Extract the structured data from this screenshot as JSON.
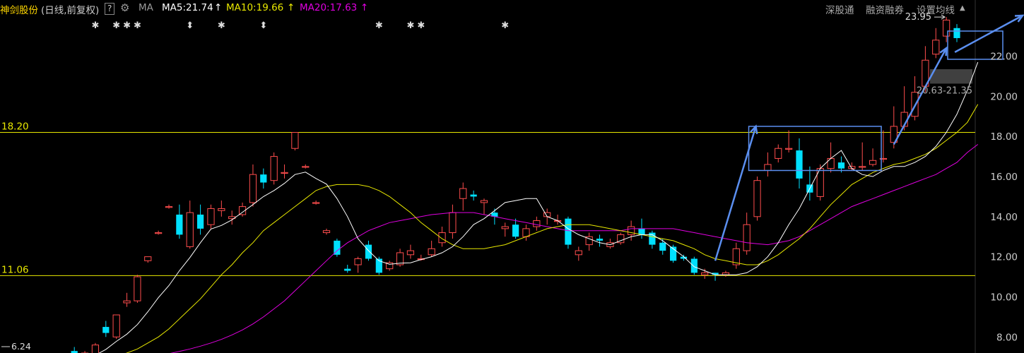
{
  "header": {
    "stock_name": "神剑股份",
    "period_info": "(日线,前复权)",
    "help": "?",
    "ma_label": "MA",
    "ma5": "MA5:21.74",
    "ma10": "MA10:19.66",
    "ma20": "MA20:17.63",
    "arrow": "↑",
    "btn_shenguotong": "深股通",
    "btn_margin": "融资融券",
    "btn_ma_settings": "设置均线"
  },
  "colors": {
    "up": "#ff4d4d",
    "down": "#00e0ff",
    "ma5": "#ffffff",
    "ma10": "#e8e800",
    "ma20": "#e000e0",
    "hline": "#e8e800",
    "annotation": "#5b8ff0",
    "axis_text": "#cccccc"
  },
  "chart_data": {
    "type": "candlestick",
    "y_range": [
      7.2,
      24.8
    ],
    "y_ticks": [
      "8.00",
      "10.00",
      "12.00",
      "14.00",
      "16.00",
      "18.00",
      "20.00",
      "22.00"
    ],
    "y_tick_values": [
      8,
      10,
      12,
      14,
      16,
      18,
      20,
      22
    ],
    "support_line": {
      "value": 11.06,
      "label": "11.06"
    },
    "resistance_line": {
      "value": 18.2,
      "label": "18.20"
    },
    "low_label": "6.24",
    "high_label": "23.95",
    "range_label": "20.63-21.35",
    "range_band": [
      20.63,
      21.35
    ],
    "events_star": [
      8,
      10,
      11,
      12,
      20,
      35,
      38,
      39,
      47
    ],
    "events_diamond": [
      17,
      24
    ],
    "candles": [
      [
        6.6,
        6.65,
        6.5,
        6.7
      ],
      [
        6.65,
        6.7,
        6.6,
        6.75
      ],
      [
        6.7,
        6.65,
        6.55,
        6.8
      ],
      [
        6.65,
        6.75,
        6.6,
        6.8
      ],
      [
        6.75,
        6.7,
        6.6,
        6.8
      ],
      [
        6.7,
        6.8,
        6.6,
        6.85
      ],
      [
        7.3,
        7.1,
        6.9,
        7.5
      ],
      [
        7.0,
        7.2,
        6.9,
        7.3
      ],
      [
        7.1,
        7.6,
        6.9,
        7.7
      ],
      [
        8.5,
        8.2,
        8.0,
        8.8
      ],
      [
        8.0,
        9.1,
        7.9,
        9.1
      ],
      [
        9.7,
        9.8,
        9.5,
        10.2
      ],
      [
        9.8,
        11.0,
        9.7,
        11.1
      ],
      [
        11.8,
        12.0,
        11.7,
        12.0
      ],
      [
        13.2,
        13.2,
        13.1,
        13.3
      ],
      [
        14.5,
        14.5,
        14.4,
        14.6
      ],
      [
        14.1,
        13.1,
        12.9,
        14.6
      ],
      [
        12.5,
        14.2,
        12.4,
        14.8
      ],
      [
        14.1,
        13.4,
        13.1,
        14.6
      ],
      [
        13.6,
        14.4,
        13.4,
        14.6
      ],
      [
        14.3,
        14.4,
        14.0,
        14.8
      ],
      [
        13.9,
        14.0,
        13.6,
        14.3
      ],
      [
        14.1,
        14.5,
        14.0,
        14.7
      ],
      [
        14.7,
        16.1,
        14.5,
        16.6
      ],
      [
        16.1,
        15.7,
        15.4,
        16.4
      ],
      [
        15.8,
        17.0,
        15.6,
        17.2
      ],
      [
        16.2,
        16.2,
        15.9,
        16.6
      ],
      [
        17.4,
        18.2,
        17.3,
        18.2
      ],
      [
        16.5,
        16.5,
        16.4,
        16.6
      ],
      [
        14.7,
        14.7,
        14.6,
        14.8
      ],
      [
        13.2,
        13.3,
        13.1,
        13.4
      ],
      [
        12.8,
        12.1,
        12.0,
        12.9
      ],
      [
        11.4,
        11.3,
        11.2,
        11.6
      ],
      [
        11.6,
        11.9,
        11.2,
        12.0
      ],
      [
        12.6,
        11.9,
        11.8,
        12.8
      ],
      [
        11.9,
        11.2,
        11.1,
        12.0
      ],
      [
        11.4,
        11.7,
        11.3,
        11.8
      ],
      [
        11.6,
        12.2,
        11.5,
        12.4
      ],
      [
        12.1,
        12.3,
        11.9,
        12.6
      ],
      [
        11.9,
        11.9,
        11.8,
        12.1
      ],
      [
        12.1,
        12.4,
        12.0,
        12.8
      ],
      [
        12.7,
        13.2,
        12.5,
        13.5
      ],
      [
        13.2,
        14.2,
        12.9,
        14.6
      ],
      [
        14.9,
        15.4,
        14.3,
        15.7
      ],
      [
        15.1,
        15.0,
        14.8,
        15.3
      ],
      [
        14.7,
        14.8,
        14.1,
        14.9
      ],
      [
        14.2,
        14.0,
        13.6,
        14.4
      ],
      [
        13.4,
        13.5,
        13.0,
        13.7
      ],
      [
        13.6,
        13.0,
        12.9,
        13.9
      ],
      [
        13.0,
        13.4,
        12.8,
        13.6
      ],
      [
        13.5,
        13.8,
        13.3,
        14.0
      ],
      [
        14.0,
        14.2,
        13.6,
        14.4
      ],
      [
        13.8,
        13.8,
        13.6,
        14.1
      ],
      [
        13.9,
        12.6,
        12.4,
        14.0
      ],
      [
        12.1,
        12.3,
        11.8,
        12.5
      ],
      [
        12.6,
        13.0,
        12.3,
        13.2
      ],
      [
        12.9,
        12.8,
        12.5,
        13.1
      ],
      [
        12.5,
        12.7,
        12.4,
        12.9
      ],
      [
        12.7,
        13.1,
        12.6,
        13.2
      ],
      [
        13.1,
        13.5,
        12.8,
        13.8
      ],
      [
        13.4,
        13.1,
        12.9,
        13.9
      ],
      [
        13.2,
        12.6,
        12.4,
        13.3
      ],
      [
        12.7,
        12.3,
        12.1,
        12.9
      ],
      [
        12.5,
        11.8,
        11.7,
        12.6
      ],
      [
        12.0,
        11.9,
        11.8,
        12.1
      ],
      [
        11.9,
        11.2,
        11.1,
        12.0
      ],
      [
        11.1,
        11.2,
        10.9,
        11.4
      ],
      [
        11.2,
        11.1,
        10.8,
        11.2
      ],
      [
        11.1,
        11.2,
        11.0,
        11.3
      ],
      [
        11.6,
        12.4,
        11.4,
        12.7
      ],
      [
        12.3,
        13.6,
        12.1,
        14.2
      ],
      [
        14.0,
        15.8,
        13.8,
        16.0
      ],
      [
        16.3,
        16.6,
        16.0,
        17.2
      ],
      [
        16.9,
        17.4,
        16.7,
        17.6
      ],
      [
        17.4,
        17.4,
        17.2,
        18.3
      ],
      [
        17.3,
        15.9,
        15.4,
        17.9
      ],
      [
        15.6,
        15.2,
        14.8,
        16.5
      ],
      [
        15.0,
        16.4,
        14.8,
        16.6
      ],
      [
        16.4,
        16.9,
        16.2,
        17.7
      ],
      [
        16.7,
        16.4,
        16.2,
        17.0
      ],
      [
        16.4,
        16.5,
        16.3,
        16.7
      ],
      [
        16.5,
        16.5,
        16.3,
        17.7
      ],
      [
        16.6,
        16.8,
        16.5,
        17.4
      ],
      [
        16.9,
        16.9,
        16.7,
        18.3
      ],
      [
        17.7,
        18.5,
        17.4,
        19.5
      ],
      [
        18.5,
        19.2,
        18.3,
        20.5
      ],
      [
        19.0,
        20.2,
        18.8,
        21.0
      ],
      [
        20.5,
        21.8,
        20.2,
        22.5
      ],
      [
        22.1,
        22.8,
        21.9,
        23.4
      ],
      [
        23.0,
        23.8,
        22.7,
        23.95
      ],
      [
        23.4,
        22.9,
        22.7,
        23.6
      ]
    ],
    "ma5": [
      6.6,
      6.64,
      6.64,
      6.66,
      6.69,
      6.72,
      6.82,
      6.89,
      7.09,
      7.38,
      7.78,
      8.14,
      8.62,
      9.26,
      9.96,
      10.56,
      11.3,
      11.96,
      12.7,
      13.38,
      13.56,
      13.84,
      14.22,
      14.6,
      15.0,
      15.3,
      15.66,
      16.1,
      16.22,
      15.9,
      15.62,
      14.9,
      14.0,
      12.9,
      12.3,
      11.8,
      11.62,
      11.68,
      11.7,
      11.86,
      12.0,
      12.2,
      12.5,
      13.0,
      13.6,
      13.9,
      14.3,
      14.7,
      14.8,
      14.9,
      14.9,
      14.0,
      13.8,
      13.4,
      13.1,
      12.9,
      12.7,
      12.6,
      12.8,
      13.0,
      13.1,
      13.1,
      12.8,
      12.4,
      12.0,
      11.5,
      11.3,
      11.1,
      11.1,
      11.1,
      11.2,
      11.5,
      12.0,
      12.7,
      13.6,
      14.4,
      15.4,
      16.4,
      16.9,
      17.3,
      16.4,
      16.1,
      16.0,
      16.3,
      16.5,
      16.5,
      16.7,
      17.0,
      17.5,
      18.2,
      19.1,
      20.3,
      21.7
    ],
    "ma10": [
      6.6,
      6.62,
      6.64,
      6.65,
      6.67,
      6.7,
      6.74,
      6.78,
      6.85,
      6.94,
      7.05,
      7.2,
      7.4,
      7.7,
      8.0,
      8.4,
      8.9,
      9.4,
      9.9,
      10.5,
      11.1,
      11.6,
      12.2,
      12.7,
      13.3,
      13.7,
      14.1,
      14.5,
      14.9,
      15.3,
      15.5,
      15.6,
      15.6,
      15.6,
      15.5,
      15.3,
      15.0,
      14.6,
      14.2,
      13.7,
      13.3,
      12.9,
      12.6,
      12.4,
      12.4,
      12.4,
      12.5,
      12.6,
      12.8,
      13.0,
      13.2,
      13.4,
      13.5,
      13.6,
      13.6,
      13.6,
      13.5,
      13.4,
      13.3,
      13.2,
      13.1,
      13.0,
      12.9,
      12.8,
      12.6,
      12.4,
      12.1,
      11.9,
      11.8,
      11.7,
      11.6,
      11.6,
      11.8,
      12.1,
      12.5,
      12.9,
      13.4,
      14.0,
      14.6,
      15.1,
      15.6,
      15.9,
      16.2,
      16.4,
      16.6,
      16.7,
      16.9,
      17.1,
      17.4,
      17.8,
      18.2,
      18.7,
      19.6
    ],
    "ma20": [
      6.5,
      6.52,
      6.54,
      6.56,
      6.58,
      6.6,
      6.62,
      6.65,
      6.68,
      6.72,
      6.77,
      6.83,
      6.9,
      6.98,
      7.07,
      7.17,
      7.28,
      7.4,
      7.54,
      7.7,
      7.88,
      8.1,
      8.35,
      8.65,
      9.0,
      9.4,
      9.8,
      10.3,
      10.8,
      11.3,
      11.8,
      12.3,
      12.7,
      13.0,
      13.3,
      13.5,
      13.7,
      13.8,
      13.9,
      14.0,
      14.1,
      14.15,
      14.2,
      14.2,
      14.2,
      14.1,
      14.0,
      13.9,
      13.8,
      13.7,
      13.6,
      13.5,
      13.4,
      13.3,
      13.3,
      13.3,
      13.3,
      13.3,
      13.3,
      13.4,
      13.4,
      13.4,
      13.4,
      13.4,
      13.3,
      13.2,
      13.1,
      13.0,
      12.9,
      12.8,
      12.7,
      12.65,
      12.6,
      12.7,
      12.8,
      13.0,
      13.3,
      13.6,
      13.9,
      14.2,
      14.5,
      14.7,
      14.9,
      15.1,
      15.3,
      15.5,
      15.7,
      15.9,
      16.1,
      16.4,
      16.7,
      17.2,
      17.6
    ]
  }
}
